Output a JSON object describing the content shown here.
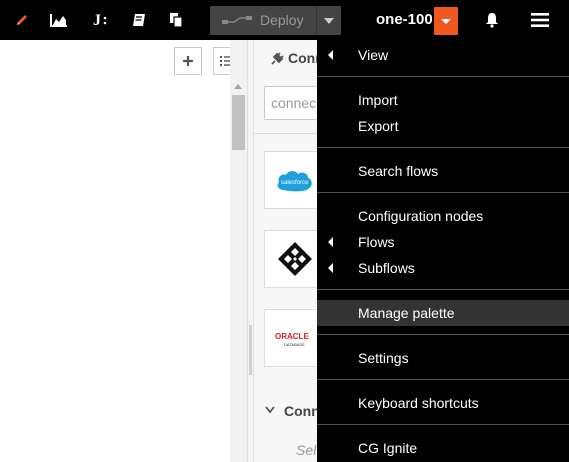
{
  "toolbar": {
    "icons": [
      "edit-pencil-icon",
      "dashboard-chart-icon",
      "jupyter-icon",
      "book-icon",
      "copy-icon"
    ],
    "deploy_label": "Deploy",
    "project_name": "one-100",
    "accent_color": "#f0581f"
  },
  "canvas": {
    "add_button_icon": "plus-icon",
    "list_button_icon": "list-icon"
  },
  "palette": {
    "title": "Conn",
    "search_placeholder": "connec",
    "cards": [
      {
        "name": "salesforce",
        "logo_text": "salesforce"
      },
      {
        "name": "lattice",
        "logo_text": ""
      },
      {
        "name": "oracle",
        "logo_text": "ORACLE",
        "logo_subtext": "DATABASE"
      }
    ],
    "section_title": "Conn",
    "section_hint": "Sel"
  },
  "menu": {
    "items": [
      {
        "label": "View",
        "submenu": true
      },
      {
        "label": "Import",
        "submenu": false
      },
      {
        "label": "Export",
        "submenu": false
      },
      {
        "label": "Search flows",
        "submenu": false
      },
      {
        "label": "Configuration nodes",
        "submenu": false
      },
      {
        "label": "Flows",
        "submenu": true
      },
      {
        "label": "Subflows",
        "submenu": true
      },
      {
        "label": "Manage palette",
        "submenu": false,
        "active": true
      },
      {
        "label": "Settings",
        "submenu": false
      },
      {
        "label": "Keyboard shortcuts",
        "submenu": false
      },
      {
        "label": "CG Ignite",
        "submenu": false
      }
    ]
  }
}
